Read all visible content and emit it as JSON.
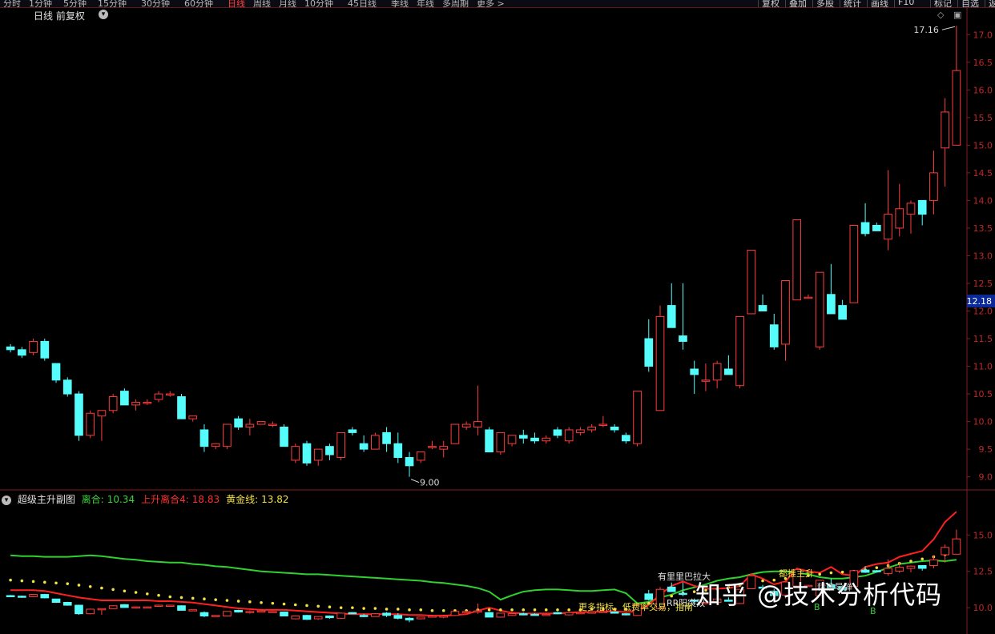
{
  "toolbar": {
    "periods": [
      "分时",
      "1分钟",
      "5分钟",
      "15分钟",
      "30分钟",
      "60分钟",
      "日线",
      "周线",
      "月线",
      "10分钟",
      "45日线",
      "季线",
      "年线",
      "多周期",
      "更多 >"
    ],
    "active_period": "日线",
    "tools": [
      "复权",
      "叠加",
      "多股",
      "统计",
      "画线",
      "F10",
      "标记",
      "自选",
      "返回"
    ]
  },
  "main_title": "日线 前复权",
  "sub_indicator": {
    "name": "超级主升副图",
    "items": [
      {
        "label": "离合:",
        "value": "10.34",
        "color": "#3ad23a"
      },
      {
        "label": "上升离合4:",
        "value": "18.83",
        "color": "#ff3030"
      },
      {
        "label": "黄金线:",
        "value": "13.82",
        "color": "#f0e040"
      }
    ]
  },
  "annotations": {
    "high_label": "17.16",
    "low_label": "9.00",
    "current_price": "12.18",
    "sub_texts": [
      "有里里巴拉大",
      "RR阳突双",
      "更多指标，低费率交易，指南",
      "都推主升",
      "精准导弹",
      "B",
      "B"
    ]
  },
  "watermark": "知乎 @技术分析代码",
  "chart_data": [
    {
      "type": "candlestick",
      "title": "日线 前复权",
      "ylim": [
        8.85,
        17.25
      ],
      "y_ticks": [
        9.0,
        9.5,
        10.0,
        10.5,
        11.0,
        11.5,
        12.0,
        12.5,
        13.0,
        13.5,
        14.0,
        14.5,
        15.0,
        15.5,
        16.0,
        16.5,
        17.0
      ],
      "ohlc": [
        [
          11.35,
          11.4,
          11.25,
          11.3
        ],
        [
          11.3,
          11.35,
          11.15,
          11.2
        ],
        [
          11.25,
          11.5,
          11.2,
          11.45
        ],
        [
          11.45,
          11.5,
          11.1,
          11.15
        ],
        [
          11.05,
          11.05,
          10.7,
          10.75
        ],
        [
          10.75,
          10.8,
          10.45,
          10.5
        ],
        [
          10.5,
          10.55,
          9.65,
          9.75
        ],
        [
          9.75,
          10.2,
          9.7,
          10.15
        ],
        [
          10.1,
          10.2,
          9.65,
          10.2
        ],
        [
          10.2,
          10.5,
          10.15,
          10.45
        ],
        [
          10.55,
          10.6,
          10.3,
          10.3
        ],
        [
          10.3,
          10.4,
          10.2,
          10.35
        ],
        [
          10.35,
          10.4,
          10.3,
          10.35
        ],
        [
          10.4,
          10.55,
          10.35,
          10.5
        ],
        [
          10.5,
          10.55,
          10.45,
          10.5
        ],
        [
          10.45,
          10.5,
          10.05,
          10.05
        ],
        [
          10.05,
          10.1,
          10.0,
          10.1
        ],
        [
          9.85,
          9.95,
          9.45,
          9.55
        ],
        [
          9.55,
          9.6,
          9.5,
          9.6
        ],
        [
          9.55,
          9.95,
          9.5,
          9.95
        ],
        [
          10.05,
          10.1,
          9.85,
          9.9
        ],
        [
          9.9,
          10.05,
          9.75,
          9.95
        ],
        [
          9.95,
          10.0,
          9.95,
          10.0
        ],
        [
          9.95,
          10.0,
          9.9,
          9.95
        ],
        [
          9.9,
          9.95,
          9.65,
          9.55
        ],
        [
          9.3,
          9.6,
          9.25,
          9.55
        ],
        [
          9.6,
          9.65,
          9.2,
          9.25
        ],
        [
          9.3,
          9.5,
          9.2,
          9.5
        ],
        [
          9.55,
          9.6,
          9.3,
          9.4
        ],
        [
          9.35,
          9.8,
          9.3,
          9.8
        ],
        [
          9.85,
          9.9,
          9.75,
          9.8
        ],
        [
          9.6,
          9.75,
          9.45,
          9.5
        ],
        [
          9.5,
          9.8,
          9.5,
          9.75
        ],
        [
          9.8,
          9.9,
          9.45,
          9.6
        ],
        [
          9.6,
          9.8,
          9.25,
          9.35
        ],
        [
          9.35,
          9.45,
          9.0,
          9.2
        ],
        [
          9.3,
          9.45,
          9.25,
          9.45
        ],
        [
          9.55,
          9.65,
          9.5,
          9.55
        ],
        [
          9.5,
          9.65,
          9.35,
          9.55
        ],
        [
          9.6,
          9.95,
          9.6,
          9.95
        ],
        [
          9.9,
          10.0,
          9.85,
          9.95
        ],
        [
          9.9,
          10.65,
          9.75,
          10.0
        ],
        [
          9.85,
          9.9,
          9.5,
          9.45
        ],
        [
          9.45,
          9.8,
          9.4,
          9.8
        ],
        [
          9.6,
          9.75,
          9.55,
          9.75
        ],
        [
          9.75,
          9.85,
          9.6,
          9.7
        ],
        [
          9.7,
          9.8,
          9.6,
          9.65
        ],
        [
          9.65,
          9.75,
          9.6,
          9.7
        ],
        [
          9.85,
          9.9,
          9.7,
          9.75
        ],
        [
          9.65,
          9.9,
          9.6,
          9.85
        ],
        [
          9.8,
          9.9,
          9.75,
          9.85
        ],
        [
          9.85,
          9.95,
          9.8,
          9.9
        ],
        [
          9.95,
          10.1,
          9.9,
          9.95
        ],
        [
          9.9,
          9.95,
          9.8,
          9.85
        ],
        [
          9.75,
          9.8,
          9.6,
          9.65
        ],
        [
          9.6,
          10.55,
          9.55,
          10.55
        ],
        [
          11.5,
          11.85,
          10.9,
          11.0
        ],
        [
          10.2,
          12.1,
          10.2,
          11.9
        ],
        [
          12.1,
          12.5,
          11.8,
          11.7
        ],
        [
          11.55,
          12.5,
          11.3,
          11.45
        ],
        [
          10.95,
          11.1,
          10.5,
          10.85
        ],
        [
          10.75,
          11.05,
          10.55,
          10.75
        ],
        [
          10.75,
          11.1,
          10.6,
          11.05
        ],
        [
          10.95,
          11.2,
          10.85,
          10.85
        ],
        [
          10.65,
          11.9,
          10.6,
          11.9
        ],
        [
          11.95,
          13.1,
          11.95,
          13.1
        ],
        [
          12.1,
          12.3,
          12.0,
          12.0
        ],
        [
          11.75,
          11.95,
          11.3,
          11.35
        ],
        [
          11.4,
          12.5,
          11.1,
          12.55
        ],
        [
          12.2,
          13.65,
          12.2,
          13.65
        ],
        [
          12.25,
          12.3,
          12.25,
          12.25
        ],
        [
          11.35,
          12.7,
          11.3,
          12.7
        ],
        [
          12.3,
          12.85,
          11.95,
          11.95
        ],
        [
          12.1,
          12.2,
          11.85,
          11.85
        ],
        [
          12.15,
          13.55,
          12.15,
          13.55
        ],
        [
          13.6,
          13.95,
          13.35,
          13.4
        ],
        [
          13.55,
          13.6,
          13.45,
          13.45
        ],
        [
          13.3,
          14.55,
          13.1,
          13.75
        ],
        [
          13.5,
          14.3,
          13.35,
          13.85
        ],
        [
          13.75,
          14.0,
          13.4,
          13.95
        ],
        [
          14.0,
          14.0,
          13.55,
          13.75
        ],
        [
          14.0,
          14.9,
          13.75,
          14.5
        ],
        [
          14.95,
          15.85,
          14.25,
          15.6
        ],
        [
          15.0,
          17.16,
          15.0,
          16.35
        ]
      ],
      "annotations": [
        {
          "text": "17.16",
          "type": "high"
        },
        {
          "text": "9.00",
          "type": "low"
        }
      ],
      "current_price": 12.18
    },
    {
      "type": "line",
      "title": "超级主升副图",
      "ylim": [
        8.3,
        17.0
      ],
      "y_ticks": [
        10.0,
        12.5,
        15.0
      ],
      "series": [
        {
          "name": "离合",
          "color": "#2fd02f",
          "values": [
            13.6,
            13.55,
            13.55,
            13.5,
            13.5,
            13.5,
            13.55,
            13.6,
            13.55,
            13.45,
            13.35,
            13.3,
            13.2,
            13.15,
            13.1,
            13.1,
            13.0,
            12.95,
            12.85,
            12.8,
            12.7,
            12.6,
            12.5,
            12.45,
            12.4,
            12.35,
            12.3,
            12.3,
            12.25,
            12.2,
            12.15,
            12.1,
            12.05,
            12.0,
            11.95,
            11.9,
            11.85,
            11.75,
            11.7,
            11.6,
            11.5,
            11.35,
            11.1,
            10.55,
            10.85,
            11.1,
            11.2,
            11.25,
            11.25,
            11.2,
            11.15,
            11.15,
            11.2,
            11.25,
            11.0,
            10.3,
            10.4,
            10.7,
            10.9,
            11.2,
            11.4,
            11.6,
            11.85,
            12.0,
            12.1,
            12.3,
            12.45,
            12.5,
            12.5,
            12.4,
            12.3,
            12.1,
            12.0,
            12.0,
            12.1,
            12.2,
            12.45,
            12.75,
            13.0,
            13.1,
            13.2,
            13.25,
            13.2,
            13.3
          ]
        },
        {
          "name": "上升离合4",
          "color": "#ff2020",
          "values": [
            11.2,
            11.2,
            11.2,
            11.15,
            11.0,
            10.85,
            10.7,
            10.6,
            10.5,
            10.5,
            10.5,
            10.5,
            10.5,
            10.45,
            10.45,
            10.4,
            10.35,
            10.25,
            10.15,
            10.05,
            9.95,
            9.9,
            9.85,
            9.85,
            9.85,
            9.8,
            9.75,
            9.7,
            9.65,
            9.6,
            9.55,
            9.55,
            9.55,
            9.55,
            9.55,
            9.5,
            9.5,
            9.45,
            9.45,
            9.5,
            9.55,
            9.8,
            10.0,
            9.8,
            9.65,
            9.6,
            9.6,
            9.6,
            9.6,
            9.65,
            9.7,
            9.7,
            9.75,
            9.75,
            9.7,
            9.75,
            10.2,
            10.9,
            11.5,
            11.8,
            11.5,
            11.3,
            11.3,
            11.35,
            11.5,
            12.3,
            12.0,
            11.6,
            11.8,
            12.7,
            12.5,
            12.4,
            12.8,
            12.3,
            12.2,
            12.8,
            13.0,
            13.1,
            13.5,
            13.7,
            13.9,
            14.7,
            15.9,
            16.6
          ]
        },
        {
          "name": "黄金线",
          "color": "#f0e040",
          "style": "dots",
          "values": [
            11.9,
            11.85,
            11.8,
            11.75,
            11.7,
            11.65,
            11.55,
            11.45,
            11.35,
            11.25,
            11.15,
            11.05,
            10.95,
            10.85,
            10.75,
            10.7,
            10.65,
            10.6,
            10.55,
            10.5,
            10.45,
            10.4,
            10.35,
            10.3,
            10.25,
            10.2,
            10.15,
            10.1,
            10.05,
            10.0,
            10.0,
            9.95,
            9.95,
            9.9,
            9.9,
            9.85,
            9.85,
            9.8,
            9.8,
            9.8,
            9.8,
            9.85,
            9.85,
            9.85,
            9.85,
            9.85,
            9.85,
            9.85,
            9.85,
            9.85,
            9.85,
            9.9,
            9.9,
            9.9,
            9.9,
            10.0,
            10.3,
            10.55,
            10.8,
            11.0,
            11.1,
            11.2,
            11.3,
            11.4,
            11.55,
            11.75,
            11.85,
            11.9,
            12.0,
            12.15,
            12.2,
            12.3,
            12.4,
            12.45,
            12.5,
            12.6,
            12.75,
            12.9,
            13.05,
            13.2,
            13.35,
            13.5,
            13.65,
            13.82
          ]
        }
      ]
    }
  ]
}
